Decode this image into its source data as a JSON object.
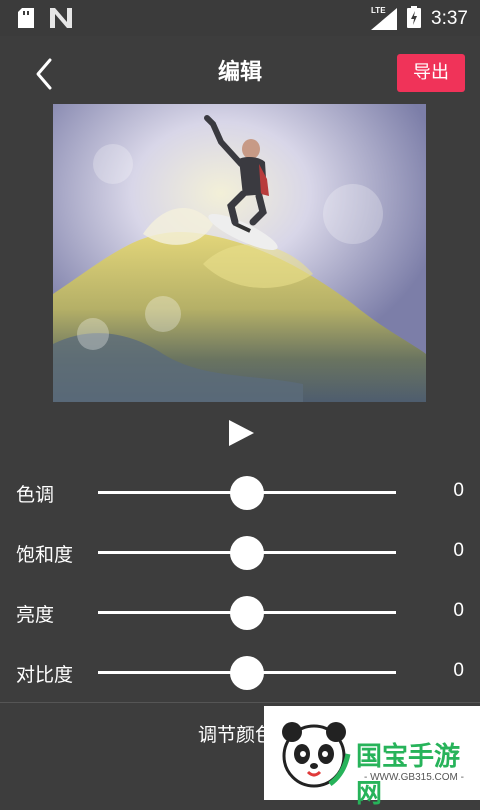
{
  "status_bar": {
    "time": "3:37",
    "network": "LTE",
    "icons": [
      "sd-card-icon",
      "n-notification-icon",
      "signal-icon",
      "battery-icon"
    ]
  },
  "toolbar": {
    "title": "编辑",
    "export_label": "导出",
    "back_icon": "chevron-left-icon"
  },
  "preview": {
    "play_icon": "play-icon"
  },
  "adjustments": [
    {
      "label": "色调",
      "value": "0",
      "level": 0.5
    },
    {
      "label": "饱和度",
      "value": "0",
      "level": 0.5
    },
    {
      "label": "亮度",
      "value": "0",
      "level": 0.5
    },
    {
      "label": "对比度",
      "value": "0",
      "level": 0.5
    }
  ],
  "bottom": {
    "label": "调节颜色"
  },
  "watermark": {
    "text": "国宝手游网",
    "sub": "- WWW.GB315.COM -"
  },
  "colors": {
    "background": "#3d3d3d",
    "accent": "#f03359",
    "text": "#ffffff"
  }
}
